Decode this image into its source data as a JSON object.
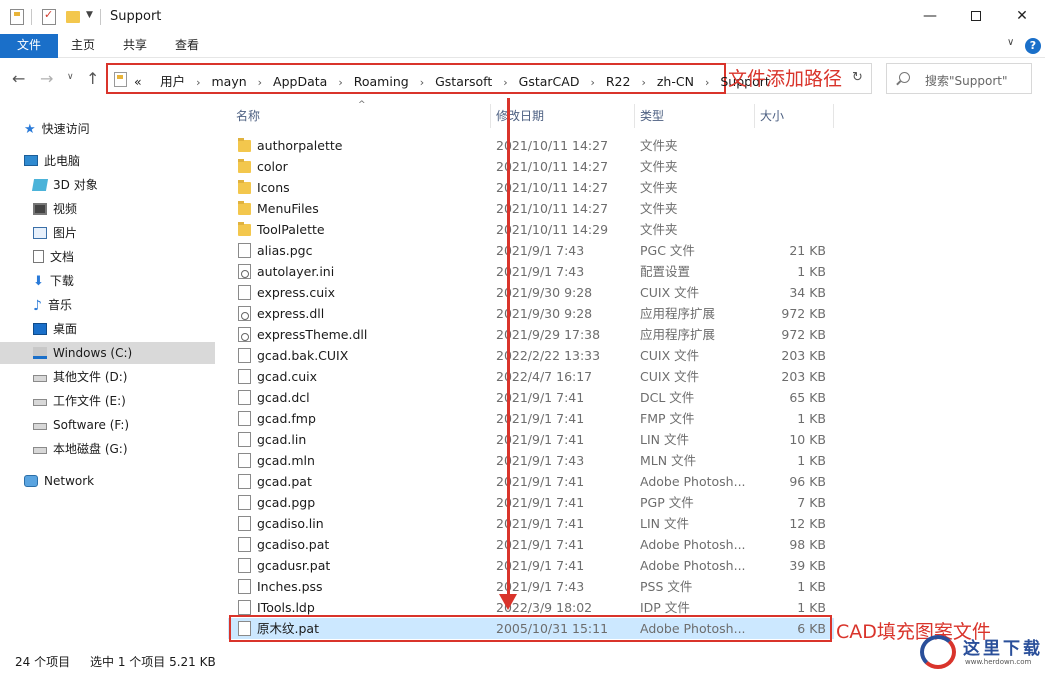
{
  "window": {
    "title": "Support",
    "minimize": "—",
    "close": "✕"
  },
  "ribbon": {
    "tabs": [
      "文件",
      "主页",
      "共享",
      "查看"
    ],
    "chevron": "∨",
    "help": "?"
  },
  "nav": {
    "back": "←",
    "forward": "→",
    "recent": "∨",
    "up": "↑",
    "overflow": "«",
    "breadcrumbs": [
      "用户",
      "mayn",
      "AppData",
      "Roaming",
      "Gstarsoft",
      "GstarCAD",
      "R22",
      "zh-CN",
      "Support"
    ],
    "breadcrumb_separator": "›",
    "refresh": "↻",
    "search_placeholder": "搜索\"Support\""
  },
  "annotations": {
    "address": "文件添加路径",
    "selected": "CAD填充图案文件"
  },
  "sidebar": {
    "items": [
      {
        "label": "快速访问",
        "icon": "star-icon"
      },
      {
        "label": "此电脑",
        "icon": "computer-icon"
      },
      {
        "label": "3D 对象",
        "icon": "3d-objects-icon"
      },
      {
        "label": "视频",
        "icon": "video-icon"
      },
      {
        "label": "图片",
        "icon": "pictures-icon"
      },
      {
        "label": "文档",
        "icon": "documents-icon"
      },
      {
        "label": "下载",
        "icon": "download-icon"
      },
      {
        "label": "音乐",
        "icon": "music-icon"
      },
      {
        "label": "桌面",
        "icon": "desktop-icon"
      },
      {
        "label": "Windows (C:)",
        "icon": "windows-drive-icon"
      },
      {
        "label": "其他文件 (D:)",
        "icon": "drive-icon"
      },
      {
        "label": "工作文件 (E:)",
        "icon": "drive-icon"
      },
      {
        "label": "Software (F:)",
        "icon": "drive-icon"
      },
      {
        "label": "本地磁盘 (G:)",
        "icon": "drive-icon"
      },
      {
        "label": "Network",
        "icon": "network-icon"
      }
    ]
  },
  "columns": {
    "name": "名称",
    "date": "修改日期",
    "type": "类型",
    "size": "大小",
    "sort_indicator": "^"
  },
  "files": [
    {
      "name": "authorpalette",
      "date": "2021/10/11 14:27",
      "type": "文件夹",
      "size": "",
      "icon": "folder"
    },
    {
      "name": "color",
      "date": "2021/10/11 14:27",
      "type": "文件夹",
      "size": "",
      "icon": "folder"
    },
    {
      "name": "Icons",
      "date": "2021/10/11 14:27",
      "type": "文件夹",
      "size": "",
      "icon": "folder"
    },
    {
      "name": "MenuFiles",
      "date": "2021/10/11 14:27",
      "type": "文件夹",
      "size": "",
      "icon": "folder"
    },
    {
      "name": "ToolPalette",
      "date": "2021/10/11 14:29",
      "type": "文件夹",
      "size": "",
      "icon": "folder"
    },
    {
      "name": "alias.pgc",
      "date": "2021/9/1 7:43",
      "type": "PGC 文件",
      "size": "21 KB",
      "icon": "file"
    },
    {
      "name": "autolayer.ini",
      "date": "2021/9/1 7:43",
      "type": "配置设置",
      "size": "1 KB",
      "icon": "gear"
    },
    {
      "name": "express.cuix",
      "date": "2021/9/30 9:28",
      "type": "CUIX 文件",
      "size": "34 KB",
      "icon": "file"
    },
    {
      "name": "express.dll",
      "date": "2021/9/30 9:28",
      "type": "应用程序扩展",
      "size": "972 KB",
      "icon": "gear"
    },
    {
      "name": "expressTheme.dll",
      "date": "2021/9/29 17:38",
      "type": "应用程序扩展",
      "size": "972 KB",
      "icon": "gear"
    },
    {
      "name": "gcad.bak.CUIX",
      "date": "2022/2/22 13:33",
      "type": "CUIX 文件",
      "size": "203 KB",
      "icon": "file"
    },
    {
      "name": "gcad.cuix",
      "date": "2022/4/7 16:17",
      "type": "CUIX 文件",
      "size": "203 KB",
      "icon": "file"
    },
    {
      "name": "gcad.dcl",
      "date": "2021/9/1 7:41",
      "type": "DCL 文件",
      "size": "65 KB",
      "icon": "file"
    },
    {
      "name": "gcad.fmp",
      "date": "2021/9/1 7:41",
      "type": "FMP 文件",
      "size": "1 KB",
      "icon": "file"
    },
    {
      "name": "gcad.lin",
      "date": "2021/9/1 7:41",
      "type": "LIN 文件",
      "size": "10 KB",
      "icon": "file"
    },
    {
      "name": "gcad.mln",
      "date": "2021/9/1 7:43",
      "type": "MLN 文件",
      "size": "1 KB",
      "icon": "file"
    },
    {
      "name": "gcad.pat",
      "date": "2021/9/1 7:41",
      "type": "Adobe Photosh...",
      "size": "96 KB",
      "icon": "file"
    },
    {
      "name": "gcad.pgp",
      "date": "2021/9/1 7:41",
      "type": "PGP 文件",
      "size": "7 KB",
      "icon": "file"
    },
    {
      "name": "gcadiso.lin",
      "date": "2021/9/1 7:41",
      "type": "LIN 文件",
      "size": "12 KB",
      "icon": "file"
    },
    {
      "name": "gcadiso.pat",
      "date": "2021/9/1 7:41",
      "type": "Adobe Photosh...",
      "size": "98 KB",
      "icon": "file"
    },
    {
      "name": "gcadusr.pat",
      "date": "2021/9/1 7:41",
      "type": "Adobe Photosh...",
      "size": "39 KB",
      "icon": "file"
    },
    {
      "name": "Inches.pss",
      "date": "2021/9/1 7:43",
      "type": "PSS 文件",
      "size": "1 KB",
      "icon": "file"
    },
    {
      "name": "ITools.ldp",
      "date": "2022/3/9 18:02",
      "type": "IDP 文件",
      "size": "1 KB",
      "icon": "file"
    },
    {
      "name": "原木纹.pat",
      "date": "2005/10/31 15:11",
      "type": "Adobe Photosh...",
      "size": "6 KB",
      "icon": "file",
      "selected": true
    }
  ],
  "status": {
    "count": "24 个项目",
    "selection": "选中 1 个项目  5.21 KB"
  },
  "watermark": {
    "text": "这里下载",
    "url": "www.herdown.com"
  }
}
